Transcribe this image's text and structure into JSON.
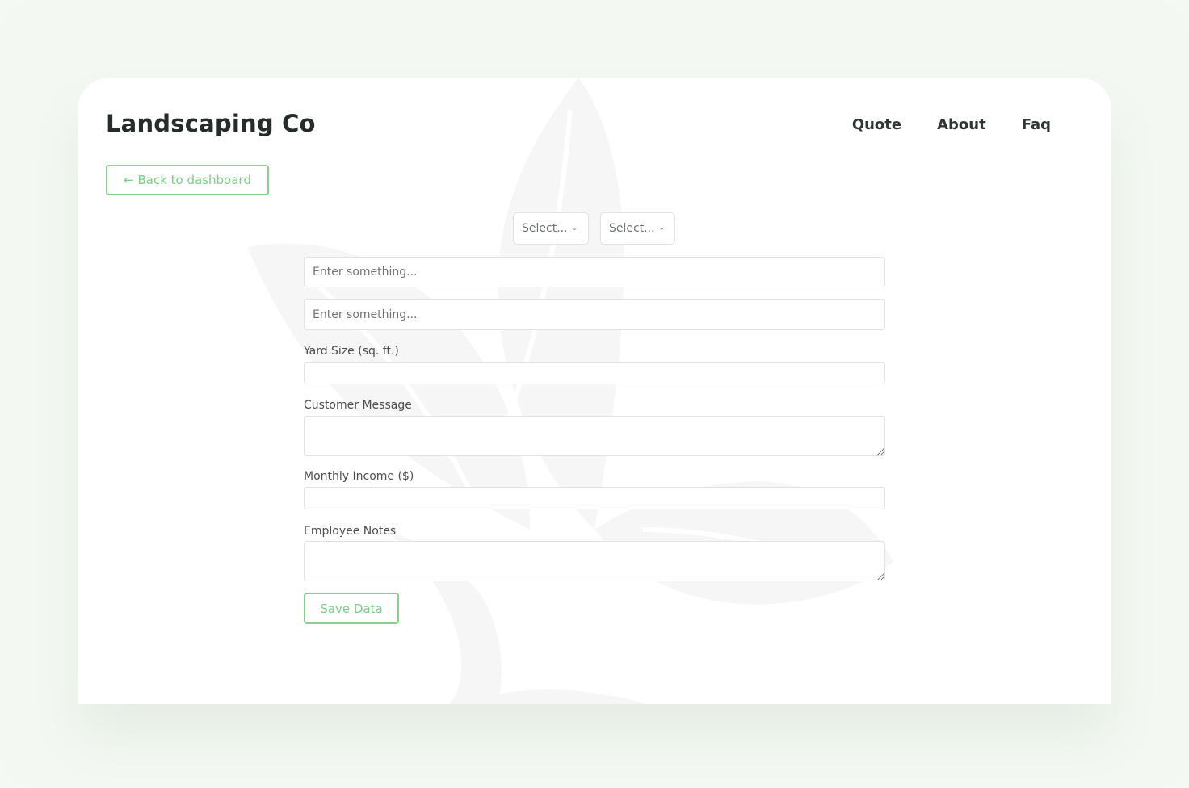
{
  "header": {
    "brand": "Landscaping Co",
    "nav": [
      "Quote",
      "About",
      "Faq"
    ]
  },
  "back_button": "← Back to dashboard",
  "selects": [
    "Select...",
    "Select..."
  ],
  "inputs": {
    "text_1_placeholder": "Enter something...",
    "text_2_placeholder": "Enter something..."
  },
  "fields": {
    "yard_size_label": "Yard Size (sq. ft.)",
    "customer_message_label": "Customer Message",
    "monthly_income_label": "Monthly Income ($)",
    "employee_notes_label": "Employee Notes"
  },
  "save_button": "Save Data",
  "colors": {
    "accent_green": "#7ccb86",
    "page_background": "#f3f9f2"
  }
}
